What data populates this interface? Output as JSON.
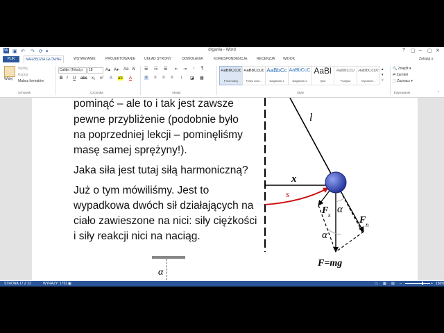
{
  "window": {
    "title": "drgania - Word",
    "controls": [
      "?",
      "▢",
      "–",
      "▢",
      "✕"
    ],
    "user": "Zaloguj s"
  },
  "tabs": {
    "file": "PLIK",
    "items": [
      "NARZĘDZIA GŁÓWNE",
      "WSTAWIANIE",
      "PROJEKTOWANIE",
      "UKŁAD STRONY",
      "ODWOŁANIA",
      "KORESPONDENCJA",
      "RECENZJA",
      "WIDOK"
    ]
  },
  "ribbon": {
    "clipboard": {
      "paste": "Wklej",
      "cut": "Wytnij",
      "copy": "Kopiuj",
      "painter": "Malarz formatów",
      "label": "Schowek"
    },
    "font": {
      "name": "Calibri (Tekst p",
      "size": "18",
      "label": "Czcionka"
    },
    "paragraph": {
      "label": "Akapit"
    },
    "styles": {
      "label": "Style",
      "items": [
        {
          "preview": "AaBbCcDc",
          "name": "¶ Normalny"
        },
        {
          "preview": "AaBbCcDc",
          "name": "¶ Bez odst..."
        },
        {
          "preview": "AaBbCc",
          "name": "Nagłówek 1"
        },
        {
          "preview": "AaBbCcC",
          "name": "Nagłówek 2"
        },
        {
          "preview": "AaBl",
          "name": "Tytuł"
        },
        {
          "preview": "AaBbCcD",
          "name": "Podtytuł"
        },
        {
          "preview": "AaBbCcDc",
          "name": "Wyróżnie..."
        }
      ]
    },
    "editing": {
      "find": "Znajdź",
      "replace": "Zamień",
      "select": "Zaznacz",
      "label": "Edytowanie"
    }
  },
  "document": {
    "lines": [
      "pominąć – ale to i tak jest zawsze",
      "pewne przybliżenie (podobnie było",
      "na poprzedniej lekcji – pominęliśmy",
      "masę samej sprężyny!).",
      "Jaka siła jest tutaj siłą harmoniczną?",
      "Już o tym mówiliśmy. Jest to",
      "wypadkowa dwóch sił działających na",
      "ciało zawieszone na nici: siły ciężkości",
      "i siły reakcji nici na naciąg."
    ],
    "diagram": {
      "labels": {
        "l": "l",
        "x": "x",
        "s": "s",
        "alpha": "α",
        "fs": "F",
        "fs_sub": "s",
        "fn": "F",
        "fn_sub": "n",
        "fmg": "F=mg"
      },
      "colors": {
        "arc": "#cc1111",
        "ball": "#3a4fbf"
      }
    },
    "lower_alpha": "α"
  },
  "statusbar": {
    "page": "STRONA 17 Z 22",
    "words": "WYRAZY: 1752",
    "zoom": "150%"
  }
}
